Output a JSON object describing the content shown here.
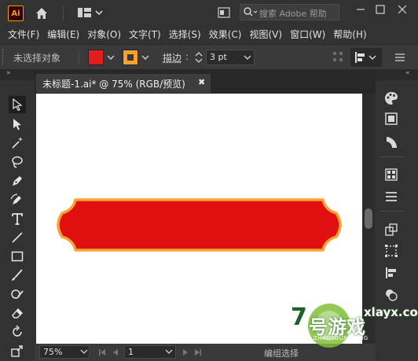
{
  "app": {
    "logo_text": "Ai"
  },
  "titlebar": {
    "search_placeholder": "搜索 Adobe 帮助",
    "icons": [
      "home-icon",
      "workspace-layout-icon",
      "panel-toggle-icon",
      "search-icon"
    ],
    "window_controls": [
      "minimize",
      "maximize",
      "close"
    ]
  },
  "menu": [
    "文件(F)",
    "编辑(E)",
    "对象(O)",
    "文字(T)",
    "选择(S)",
    "效果(C)",
    "视图(V)",
    "窗口(W)",
    "帮助(H)"
  ],
  "controlbar": {
    "selection_label": "未选择对象",
    "fill_color": "#e01e1e",
    "stroke_color": "#f7a12e",
    "stroke_label": "描边",
    "stroke_value": "3 pt"
  },
  "document": {
    "tab_title": "未标题-1.ai* @ 75% (RGB/预览)",
    "close_glyph": "✖",
    "shape": {
      "fill": "#e01010",
      "stroke": "#f6a332"
    }
  },
  "statusbar": {
    "zoom": "75%",
    "page": "1",
    "status_text": "编组选择"
  },
  "watermark": {
    "site": "xlayx.com",
    "brand": "号游戏",
    "sub": "ZHAOYOUXIWANG",
    "prefix": "7"
  },
  "tools_left": [
    "selection-tool",
    "direct-selection-tool",
    "magic-wand-tool",
    "lasso-tool",
    "pen-tool",
    "curvature-tool",
    "type-tool",
    "line-tool",
    "rectangle-tool",
    "paintbrush-tool",
    "shaper-tool",
    "eraser-tool",
    "rotate-tool",
    "scale-tool"
  ],
  "tools_right": [
    "color-panel",
    "swatches-panel",
    "color-guide-panel",
    "properties-panel",
    "layers-panel",
    "transform-panel",
    "align-panel",
    "pathfinder-panel",
    "appearance-panel"
  ]
}
